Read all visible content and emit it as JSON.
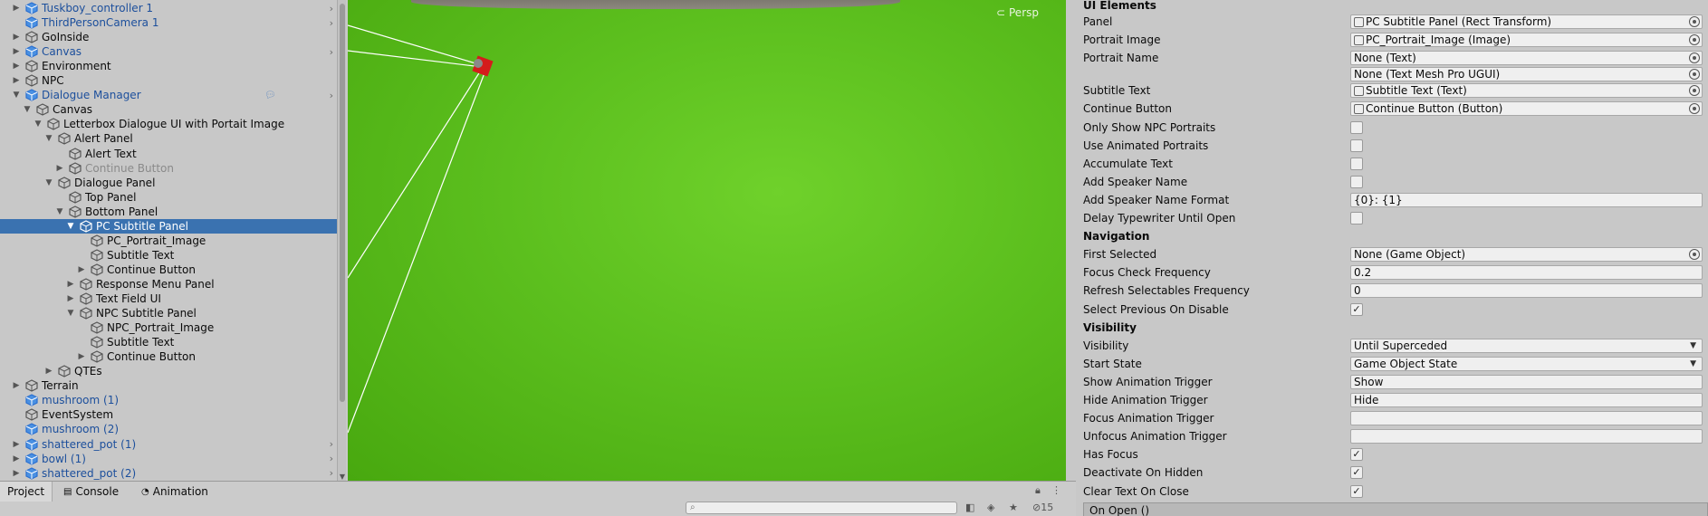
{
  "hierarchy": {
    "rows": [
      {
        "label": "Tuskboy_controller 1",
        "indent": 0,
        "arrow": "▶",
        "prefab": true,
        "chevron": true
      },
      {
        "label": "ThirdPersonCamera 1",
        "indent": 0,
        "arrow": "",
        "prefab": true,
        "chevron": true
      },
      {
        "label": "GoInside",
        "indent": 0,
        "arrow": "▶",
        "prefab": false
      },
      {
        "label": "Canvas",
        "indent": 0,
        "arrow": "▶",
        "prefab": true,
        "chevron": true
      },
      {
        "label": "Environment",
        "indent": 0,
        "arrow": "▶",
        "prefab": false
      },
      {
        "label": "NPC",
        "indent": 0,
        "arrow": "▶",
        "prefab": false
      },
      {
        "label": "Dialogue Manager",
        "indent": 0,
        "arrow": "▼",
        "prefab": true,
        "chevron": true,
        "extra": true
      },
      {
        "label": "Canvas",
        "indent": 1,
        "arrow": "▼",
        "prefab": false
      },
      {
        "label": "Letterbox Dialogue UI with Portait Image",
        "indent": 2,
        "arrow": "▼",
        "prefab": false
      },
      {
        "label": "Alert Panel",
        "indent": 3,
        "arrow": "▼",
        "prefab": false
      },
      {
        "label": "Alert Text",
        "indent": 4,
        "arrow": "",
        "prefab": false
      },
      {
        "label": "Continue Button",
        "indent": 4,
        "arrow": "▶",
        "prefab": false,
        "disabled": true
      },
      {
        "label": "Dialogue Panel",
        "indent": 3,
        "arrow": "▼",
        "prefab": false
      },
      {
        "label": "Top Panel",
        "indent": 4,
        "arrow": "",
        "prefab": false
      },
      {
        "label": "Bottom Panel",
        "indent": 4,
        "arrow": "▼",
        "prefab": false
      },
      {
        "label": "PC Subtitle Panel",
        "indent": 5,
        "arrow": "▼",
        "prefab": false,
        "selected": true
      },
      {
        "label": "PC_Portrait_Image",
        "indent": 6,
        "arrow": "",
        "prefab": false
      },
      {
        "label": "Subtitle Text",
        "indent": 6,
        "arrow": "",
        "prefab": false
      },
      {
        "label": "Continue Button",
        "indent": 6,
        "arrow": "▶",
        "prefab": false
      },
      {
        "label": "Response Menu Panel",
        "indent": 5,
        "arrow": "▶",
        "prefab": false
      },
      {
        "label": "Text Field UI",
        "indent": 5,
        "arrow": "▶",
        "prefab": false
      },
      {
        "label": "NPC Subtitle Panel",
        "indent": 5,
        "arrow": "▼",
        "prefab": false
      },
      {
        "label": "NPC_Portrait_Image",
        "indent": 6,
        "arrow": "",
        "prefab": false
      },
      {
        "label": "Subtitle Text",
        "indent": 6,
        "arrow": "",
        "prefab": false
      },
      {
        "label": "Continue Button",
        "indent": 6,
        "arrow": "▶",
        "prefab": false
      },
      {
        "label": "QTEs",
        "indent": 3,
        "arrow": "▶",
        "prefab": false
      },
      {
        "label": "Terrain",
        "indent": 0,
        "arrow": "▶",
        "prefab": false
      },
      {
        "label": "mushroom (1)",
        "indent": 0,
        "arrow": "",
        "prefab": true
      },
      {
        "label": "EventSystem",
        "indent": 0,
        "arrow": "",
        "prefab": false
      },
      {
        "label": "mushroom (2)",
        "indent": 0,
        "arrow": "",
        "prefab": true
      },
      {
        "label": "shattered_pot (1)",
        "indent": 0,
        "arrow": "▶",
        "prefab": true,
        "chevron": true
      },
      {
        "label": "bowl (1)",
        "indent": 0,
        "arrow": "▶",
        "prefab": true,
        "chevron": true
      },
      {
        "label": "shattered_pot (2)",
        "indent": 0,
        "arrow": "▶",
        "prefab": true,
        "chevron": true
      }
    ]
  },
  "scene": {
    "persp_label": "Persp",
    "colors": {
      "grass": "#5cbf1e",
      "gizmo": "#d41c1c"
    }
  },
  "inspector": {
    "section_ui_elements": "UI Elements",
    "fields": [
      {
        "label": "Panel",
        "type": "object",
        "value": "PC Subtitle Panel (Rect Transform)"
      },
      {
        "label": "Portrait Image",
        "type": "object",
        "value": "PC_Portrait_Image (Image)"
      },
      {
        "label": "Portrait Name",
        "type": "object",
        "value": "None (Text)"
      },
      {
        "label": "",
        "type": "object",
        "value": "None (Text Mesh Pro UGUI)"
      },
      {
        "label": "Subtitle Text",
        "type": "object",
        "value": "Subtitle Text (Text)"
      },
      {
        "label": "Continue Button",
        "type": "object",
        "value": "Continue Button (Button)"
      },
      {
        "label": "Only Show NPC Portraits",
        "type": "check",
        "checked": false
      },
      {
        "label": "Use Animated Portraits",
        "type": "check",
        "checked": false
      },
      {
        "label": "Accumulate Text",
        "type": "check",
        "checked": false
      },
      {
        "label": "Add Speaker Name",
        "type": "check",
        "checked": false
      },
      {
        "label": "Add Speaker Name Format",
        "type": "text",
        "value": "{0}: {1}"
      },
      {
        "label": "Delay Typewriter Until Open",
        "type": "check",
        "checked": false
      },
      {
        "label": "Navigation",
        "type": "header"
      },
      {
        "label": "First Selected",
        "type": "object",
        "value": "None (Game Object)"
      },
      {
        "label": "Focus Check Frequency",
        "type": "text",
        "value": "0.2"
      },
      {
        "label": "Refresh Selectables Frequency",
        "type": "text",
        "value": "0"
      },
      {
        "label": "Select Previous On Disable",
        "type": "check",
        "checked": true
      },
      {
        "label": "Visibility",
        "type": "header"
      },
      {
        "label": "Visibility",
        "type": "dropdown",
        "value": "Until Superceded"
      },
      {
        "label": "Start State",
        "type": "dropdown",
        "value": "Game Object State"
      },
      {
        "label": "Show Animation Trigger",
        "type": "text",
        "value": "Show"
      },
      {
        "label": "Hide Animation Trigger",
        "type": "text",
        "value": "Hide"
      },
      {
        "label": "Focus Animation Trigger",
        "type": "text",
        "value": ""
      },
      {
        "label": "Unfocus Animation Trigger",
        "type": "text",
        "value": ""
      },
      {
        "label": "Has Focus",
        "type": "check",
        "checked": true
      },
      {
        "label": "Deactivate On Hidden",
        "type": "check",
        "checked": true
      },
      {
        "label": "Clear Text On Close",
        "type": "check",
        "checked": true
      }
    ],
    "on_open_label": "On Open ()"
  },
  "bottombar": {
    "tabs": [
      "Project",
      "Console",
      "Animation"
    ],
    "active_tab": "Project",
    "hidden_count": "15"
  }
}
